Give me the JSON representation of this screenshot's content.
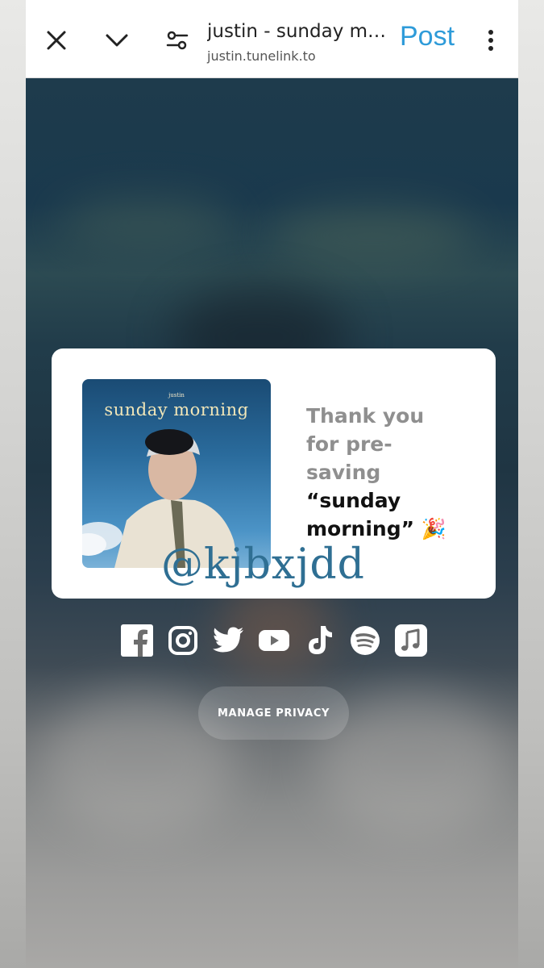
{
  "browser": {
    "title": "justin - sunday mor...",
    "url": "justin.tunelink.to",
    "post_label": "Post",
    "icons": [
      "close-icon",
      "chevron-down-icon",
      "settings-tune-icon",
      "more-vert-icon"
    ]
  },
  "card": {
    "cover": {
      "artist": "justin",
      "title": "sunday morning"
    },
    "message_line1": "Thank you",
    "message_line2": "for pre-",
    "message_line3": "saving",
    "song_name_line1": "“sunday",
    "song_name_line2": "morning”",
    "emoji": "🎉"
  },
  "watermark": "@kjbxjdd",
  "socials": [
    {
      "name": "facebook",
      "icon": "facebook-icon"
    },
    {
      "name": "instagram",
      "icon": "instagram-icon"
    },
    {
      "name": "twitter",
      "icon": "twitter-icon"
    },
    {
      "name": "youtube",
      "icon": "youtube-icon"
    },
    {
      "name": "tiktok",
      "icon": "tiktok-icon"
    },
    {
      "name": "spotify",
      "icon": "spotify-icon"
    },
    {
      "name": "apple-music",
      "icon": "music-note-icon"
    }
  ],
  "privacy_button": "MANAGE PRIVACY",
  "colors": {
    "post_blue": "#2e9bd9",
    "message_grey": "#8f8f8f",
    "watermark_blue": "#2f6f93"
  }
}
